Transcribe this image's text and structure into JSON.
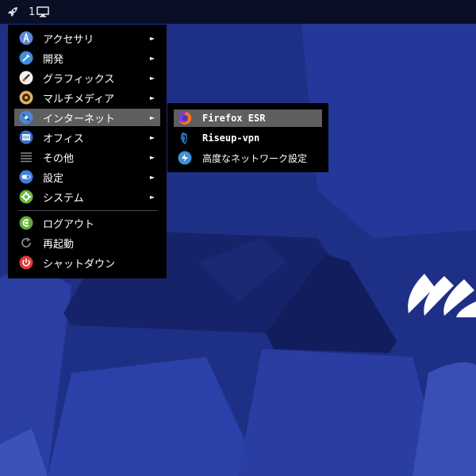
{
  "panel": {
    "workspace_number": "1",
    "launcher_icon": "rocket-icon",
    "workspace_icon": "monitor-icon"
  },
  "menu": {
    "items": [
      {
        "label": "アクセサリ",
        "icon": "accessories-icon",
        "submenu": true
      },
      {
        "label": "開発",
        "icon": "development-icon",
        "submenu": true
      },
      {
        "label": "グラフィックス",
        "icon": "graphics-icon",
        "submenu": true
      },
      {
        "label": "マルチメディア",
        "icon": "multimedia-icon",
        "submenu": true
      },
      {
        "label": "インターネット",
        "icon": "internet-icon",
        "submenu": true,
        "highlighted": true
      },
      {
        "label": "オフィス",
        "icon": "office-icon",
        "submenu": true
      },
      {
        "label": "その他",
        "icon": "other-icon",
        "submenu": true
      },
      {
        "label": "設定",
        "icon": "settings-icon",
        "submenu": true
      },
      {
        "label": "システム",
        "icon": "system-icon",
        "submenu": true
      }
    ],
    "session": [
      {
        "label": "ログアウト",
        "icon": "logout-icon"
      },
      {
        "label": "再起動",
        "icon": "reboot-icon"
      },
      {
        "label": "シャットダウン",
        "icon": "shutdown-icon"
      }
    ],
    "arrow": "►"
  },
  "submenu": {
    "items": [
      {
        "label": "Firefox ESR",
        "icon": "firefox-icon",
        "highlighted": true
      },
      {
        "label": "Riseup-vpn",
        "icon": "riseup-vpn-icon"
      },
      {
        "label": "高度なネットワーク設定",
        "icon": "network-settings-icon"
      }
    ]
  },
  "colors": {
    "wallpaper": "#1e2f86",
    "panel": "#0a0f26",
    "menu_bg": "#000000",
    "highlight": "#5f5f5f"
  }
}
